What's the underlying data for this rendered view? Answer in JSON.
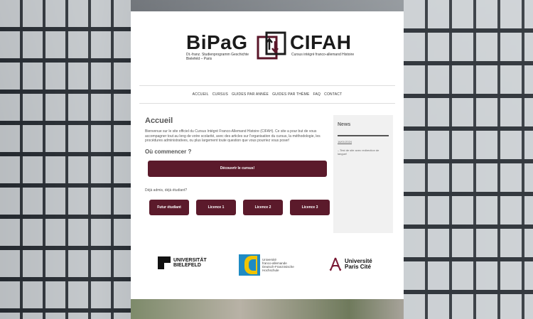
{
  "header": {
    "logo_left": "BiPaG",
    "logo_right": "CIFAH",
    "logo_left_sub": "Dt.-franz. Studienprogramm Geschichte\nBielefeld – Paris",
    "logo_right_sub": "Cursus intégré franco-allemand Histoire"
  },
  "nav": {
    "items": [
      "ACCUEIL",
      "CURSUS",
      "GUIDES PAR ANNÉE",
      "GUIDES PAR THÈME",
      "FAQ",
      "CONTACT"
    ]
  },
  "main": {
    "title": "Accueil",
    "intro": "Bienvenue sur le site officiel du Cursus Intégré Franco-Allemand Histoire (CIFAH). Ce site a pour but de vous accompagner tout au long de votre scolarité, avec des articles sur l'organisation du cursus, la méthodologie, les procédures administratives, ou plus largement toute question que vous pourriez vous poser!",
    "heading": "Où commencer ?",
    "discover_label": "Découvrir le cursus!",
    "already": "Déjà admis, déjà étudiant?",
    "buttons": [
      "Futur étudiant",
      "Licence 1",
      "Licence 2",
      "Licence 3"
    ]
  },
  "sidebar": {
    "title": "News",
    "date": "16/01/2024",
    "item": "– Test de site avec redirection de langue!"
  },
  "partners": {
    "bielefeld": "UNIVERSITÄT\nBIELEFELD",
    "ufa": "Université\nfranco-allemande\nDeutsch-Französische\nHochschule",
    "paris": "Université\nParis Cité"
  },
  "colors": {
    "accent": "#5b1a2b"
  }
}
